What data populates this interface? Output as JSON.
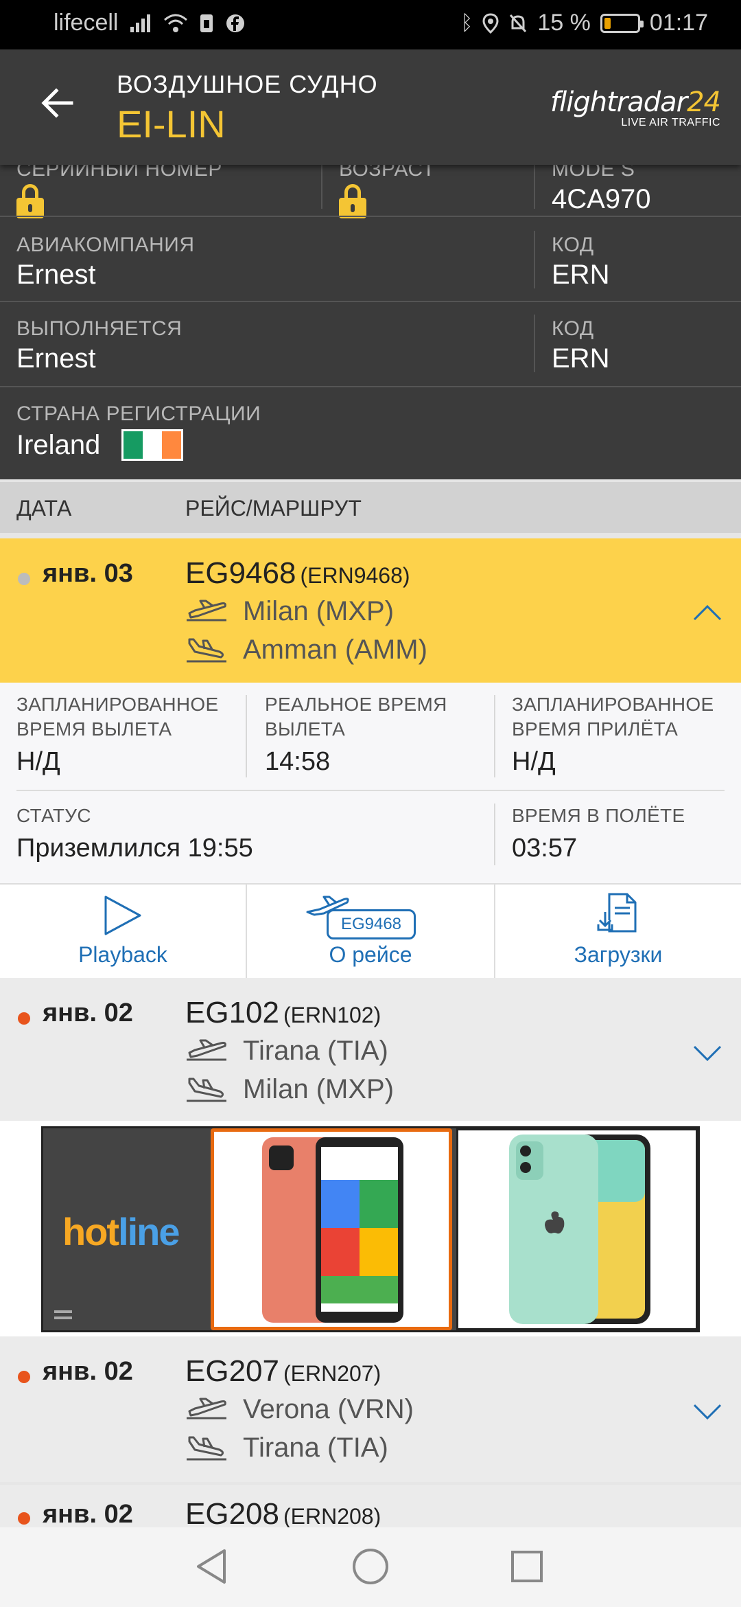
{
  "status_bar": {
    "carrier": "lifecell",
    "battery_percent": "15 %",
    "time": "01:17"
  },
  "header": {
    "subtitle": "ВОЗДУШНОЕ СУДНО",
    "title": "EI-LIN",
    "logo_main": "flightradar",
    "logo_num": "24",
    "logo_tagline": "LIVE AIR TRAFFIC"
  },
  "info": {
    "serial_label": "СЕРИЙНЫЙ НОМЕР",
    "age_label": "ВОЗРАСТ",
    "modes_label": "MODE S",
    "modes_value": "4CA970",
    "airline_label": "АВИАКОМПАНИЯ",
    "airline_value": "Ernest",
    "airline_code_label": "КОД",
    "airline_code_value": "ERN",
    "operator_label": "ВЫПОЛНЯЕТСЯ",
    "operator_value": "Ernest",
    "operator_code_label": "КОД",
    "operator_code_value": "ERN",
    "country_label": "СТРАНА РЕГИСТРАЦИИ",
    "country_value": "Ireland"
  },
  "table": {
    "col_date": "ДАТА",
    "col_route": "РЕЙС/МАРШРУТ"
  },
  "flights": [
    {
      "date": "янв. 03",
      "flight": "EG9468",
      "callsign": "(ERN9468)",
      "from": "Milan (MXP)",
      "to": "Amman (AMM)"
    },
    {
      "date": "янв. 02",
      "flight": "EG102",
      "callsign": "(ERN102)",
      "from": "Tirana (TIA)",
      "to": "Milan (MXP)"
    },
    {
      "date": "янв. 02",
      "flight": "EG207",
      "callsign": "(ERN207)",
      "from": "Verona (VRN)",
      "to": "Tirana (TIA)"
    },
    {
      "date": "янв. 02",
      "flight": "EG208",
      "callsign": "(ERN208)"
    }
  ],
  "details": {
    "sched_dep_label_1": "ЗАПЛАНИРОВАННОЕ",
    "sched_dep_label_2": "ВРЕМЯ ВЫЛЕТА",
    "sched_dep_value": "Н/Д",
    "real_dep_label_1": "РЕАЛЬНОЕ ВРЕМЯ",
    "real_dep_label_2": "ВЫЛЕТА",
    "real_dep_value": "14:58",
    "sched_arr_label_1": "ЗАПЛАНИРОВАННОЕ",
    "sched_arr_label_2": "ВРЕМЯ ПРИЛЁТА",
    "sched_arr_value": "Н/Д",
    "status_label": "СТАТУС",
    "status_value": "Приземлился 19:55",
    "flight_time_label": "ВРЕМЯ В ПОЛЁТЕ",
    "flight_time_value": "03:57"
  },
  "actions": {
    "playback": "Playback",
    "badge": "EG9468",
    "about": "О рейсе",
    "downloads": "Загрузки"
  },
  "ad": {
    "brand_part1": "hot",
    "brand_part2": "line"
  },
  "colors": {
    "header_bg": "#3b3b3b",
    "accent_yellow": "#fdd24b",
    "title_yellow": "#f4c534",
    "link_blue": "#1f6fb5",
    "dot_orange": "#e8541c",
    "dot_grey": "#bcbcbc"
  }
}
